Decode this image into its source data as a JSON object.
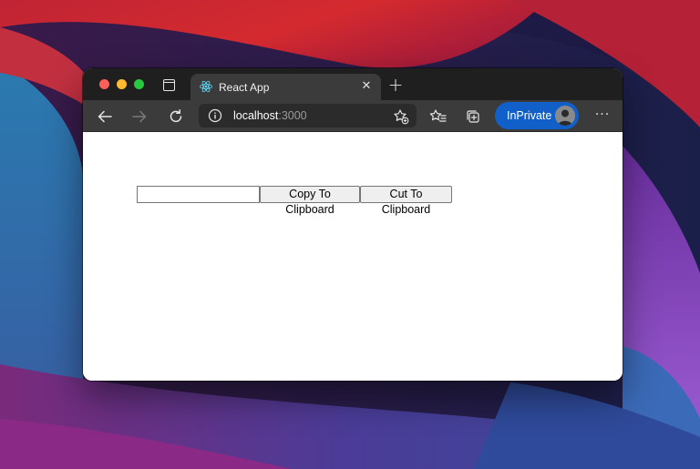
{
  "browser": {
    "tab": {
      "title": "React App",
      "favicon": "react-logo-icon",
      "close_glyph": "✕"
    },
    "new_tab_glyph": "+",
    "address_bar": {
      "host": "localhost",
      "port": ":3000"
    },
    "profile": {
      "label": "InPrivate"
    },
    "more_glyph": "···"
  },
  "page": {
    "clipboard_input": {
      "value": "",
      "placeholder": ""
    },
    "buttons": {
      "copy_label": "Copy To Clipboard",
      "cut_label": "Cut To Clipboard"
    }
  },
  "colors": {
    "inprivate_accent": "#1160c9",
    "react_blue": "#61dafb",
    "titlebar": "#1f1f1f",
    "toolbar": "#3b3b3b"
  }
}
